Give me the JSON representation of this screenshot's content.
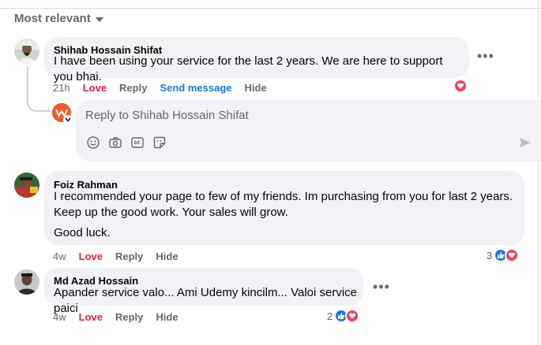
{
  "sort": {
    "label": "Most relevant"
  },
  "comments": [
    {
      "author": "Shihab Hossain Shifat",
      "text": [
        "I have been using your service for the last 2 years. We are here to support you bhai."
      ],
      "time": "21h",
      "love_label": "Love",
      "reply_label": "Reply",
      "send_label": "Send message",
      "hide_label": "Hide"
    },
    {
      "author": "Foiz Rahman",
      "text": [
        "I recommended your page to few of my friends. Im purchasing from you for last 2 years. Keep up the good work. Your sales will grow.",
        "Good luck."
      ],
      "time": "4w",
      "love_label": "Love",
      "reply_label": "Reply",
      "hide_label": "Hide",
      "reaction_count": "3"
    },
    {
      "author": "Md Azad Hossain",
      "text": [
        "Apander service valo... Ami Udemy kincilm... Valoi service paici"
      ],
      "time": "4w",
      "love_label": "Love",
      "reply_label": "Reply",
      "hide_label": "Hide",
      "reaction_count": "2"
    }
  ],
  "reply_box": {
    "placeholder": "Reply to Shihab Hossain Shifat"
  },
  "icons": {
    "more": "more-horizontal-icon",
    "love_reaction": "love-reaction-icon",
    "like_reaction": "like-reaction-icon",
    "emoji": "emoji-icon",
    "camera": "camera-icon",
    "gif": "gif-icon",
    "sticker": "sticker-icon",
    "send": "send-icon"
  },
  "colors": {
    "love": "#e41e3f",
    "link": "#1b74e4",
    "like": "#1877f2",
    "heart": "#f33e58"
  }
}
